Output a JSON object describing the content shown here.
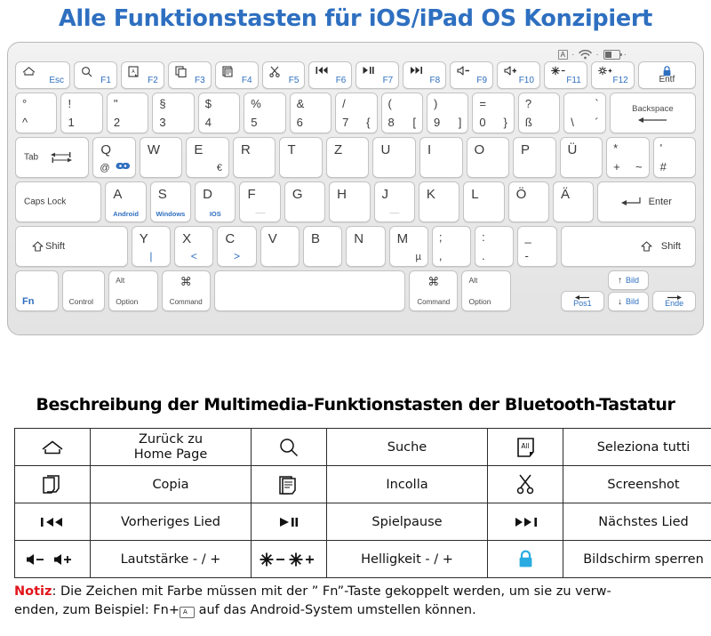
{
  "title": "Alle Funktionstasten für iOS/iPad OS Konzipiert",
  "colors": {
    "title_blue": "#2E6FC0",
    "key_blue": "#2E6FC0",
    "lock_cyan": "#29ABE2",
    "note_red": "#E1151B",
    "keyboard_body": "#EAEAEA"
  },
  "keyboard": {
    "status_icons": [
      "caps-indicator-icon",
      "bluetooth-wifi-icon",
      "battery-icon"
    ],
    "caps_indicator_label": "A",
    "rows": {
      "function_row": [
        {
          "name": "esc",
          "icon": "home-icon",
          "label": "Esc",
          "label_color": "blue"
        },
        {
          "name": "f1",
          "icon": "search-icon",
          "label": "F1",
          "label_color": "blue"
        },
        {
          "name": "f2",
          "icon": "select-all-icon",
          "label": "F2",
          "label_color": "blue"
        },
        {
          "name": "f3",
          "icon": "copy-icon",
          "label": "F3",
          "label_color": "blue"
        },
        {
          "name": "f4",
          "icon": "paste-icon",
          "label": "F4",
          "label_color": "blue"
        },
        {
          "name": "f5",
          "icon": "scissors-icon",
          "label": "F5",
          "label_color": "blue"
        },
        {
          "name": "f6",
          "icon": "previous-track-icon",
          "label": "F6",
          "label_color": "blue"
        },
        {
          "name": "f7",
          "icon": "play-pause-icon",
          "label": "F7",
          "label_color": "blue"
        },
        {
          "name": "f8",
          "icon": "next-track-icon",
          "label": "F8",
          "label_color": "blue"
        },
        {
          "name": "f9",
          "icon": "volume-down-icon",
          "label": "F9",
          "label_color": "blue"
        },
        {
          "name": "f10",
          "icon": "volume-up-icon",
          "label": "F10",
          "label_color": "blue"
        },
        {
          "name": "f11",
          "icon": "brightness-down-icon",
          "label": "F11",
          "label_color": "blue"
        },
        {
          "name": "f12",
          "icon": "brightness-up-icon",
          "label": "F12",
          "label_color": "blue"
        },
        {
          "name": "entf",
          "icon": "lock-icon",
          "label": "Entf",
          "label_color": "dark"
        }
      ],
      "number_row": [
        {
          "top": "°",
          "bottom": "^"
        },
        {
          "top": "!",
          "bottom": "1"
        },
        {
          "top": "\"",
          "bottom": "2"
        },
        {
          "top": "§",
          "bottom": "3"
        },
        {
          "top": "$",
          "bottom": "4"
        },
        {
          "top": "%",
          "bottom": "5"
        },
        {
          "top": "&",
          "bottom": "6"
        },
        {
          "top": "/",
          "bottom": "7",
          "alt": "{"
        },
        {
          "top": "(",
          "bottom": "8",
          "alt": "["
        },
        {
          "top": ")",
          "bottom": "9",
          "alt": "]"
        },
        {
          "top": "=",
          "bottom": "0",
          "alt": "}"
        },
        {
          "top": "?",
          "bottom": "ß"
        },
        {
          "top": "`",
          "bottom": "\\",
          "alt": "´"
        },
        {
          "label": "Backspace",
          "wide": true
        }
      ],
      "qwertz_row": {
        "tab_label": "Tab",
        "keys": [
          {
            "letter": "Q",
            "sub": "@",
            "icon": "bluetooth-link-icon"
          },
          {
            "letter": "W"
          },
          {
            "letter": "E",
            "sub2": "€"
          },
          {
            "letter": "R"
          },
          {
            "letter": "T"
          },
          {
            "letter": "Z"
          },
          {
            "letter": "U"
          },
          {
            "letter": "I"
          },
          {
            "letter": "O"
          },
          {
            "letter": "P"
          },
          {
            "letter": "Ü"
          },
          {
            "top": "*",
            "bottom": "+",
            "alt": "~"
          },
          {
            "top": "'",
            "bottom": "#"
          }
        ]
      },
      "home_row": {
        "caps_lock_label": "Caps Lock",
        "enter_label": "Enter",
        "keys": [
          {
            "letter": "A",
            "os": "Android"
          },
          {
            "letter": "S",
            "os": "Windows"
          },
          {
            "letter": "D",
            "os": "IOS"
          },
          {
            "letter": "F",
            "bump": true
          },
          {
            "letter": "G"
          },
          {
            "letter": "H"
          },
          {
            "letter": "J",
            "bump": true
          },
          {
            "letter": "K"
          },
          {
            "letter": "L"
          },
          {
            "letter": "Ö"
          },
          {
            "letter": "Ä"
          }
        ]
      },
      "shift_row": {
        "shift_left_label": "Shift",
        "shift_right_label": "Shift",
        "keys": [
          {
            "letter": "Y",
            "blue_sub": "|"
          },
          {
            "letter": "X",
            "blue_sub": "<"
          },
          {
            "letter": "C",
            "blue_sub": ">"
          },
          {
            "letter": "V"
          },
          {
            "letter": "B"
          },
          {
            "letter": "N"
          },
          {
            "letter": "M",
            "sub": "µ"
          },
          {
            "top": ";",
            "bottom": ","
          },
          {
            "top": ":",
            "bottom": "."
          },
          {
            "top": "_",
            "bottom": "-"
          }
        ]
      },
      "bottom_row": {
        "fn_label": "Fn",
        "control_label": "Control",
        "alt_label": "Alt",
        "option_label": "Option",
        "command_glyph": "⌘",
        "command_label": "Command",
        "space_label": "",
        "pos1_label": "Pos1",
        "bild_up_label": "Bild",
        "bild_down_label": "Bild",
        "ende_label": "Ende"
      }
    }
  },
  "section_title": "Beschreibung der Multimedia-Funktionstasten der Bluetooth-Tastatur",
  "table": {
    "rows": [
      [
        {
          "icon": "home-icon",
          "text": "Zurück zu\nHome Page",
          "text_line1": "Zurück zu",
          "text_line2": "Home Page"
        },
        {
          "icon": "search-icon",
          "text": "Suche"
        },
        {
          "icon": "select-all-icon",
          "text": "Seleziona tutti"
        }
      ],
      [
        {
          "icon": "copy-icon",
          "text": "Copia"
        },
        {
          "icon": "paste-icon",
          "text": "Incolla"
        },
        {
          "icon": "scissors-icon",
          "text": "Screenshot"
        }
      ],
      [
        {
          "icon": "previous-track-icon",
          "text": "Vorheriges Lied"
        },
        {
          "icon": "play-pause-icon",
          "text": "Spielpause"
        },
        {
          "icon": "next-track-icon",
          "text": "Nächstes Lied"
        }
      ],
      [
        {
          "icon": "volume-down-up-icon",
          "text": "Lautstärke - / +"
        },
        {
          "icon": "brightness-down-up-icon",
          "text": "Helligkeit - / +"
        },
        {
          "icon": "lock-icon-blue",
          "text": "Bildschirm sperren"
        }
      ]
    ]
  },
  "note": {
    "prefix": "Notiz",
    "line1": ": Die Zeichen mit Farbe müssen mit der ” Fn”-Taste gekoppelt werden, um sie zu verw-",
    "line2_before": "enden, zum Beispiel: Fn+",
    "inline_key_label": "A",
    "line2_after": "auf das Android-System umstellen können."
  }
}
